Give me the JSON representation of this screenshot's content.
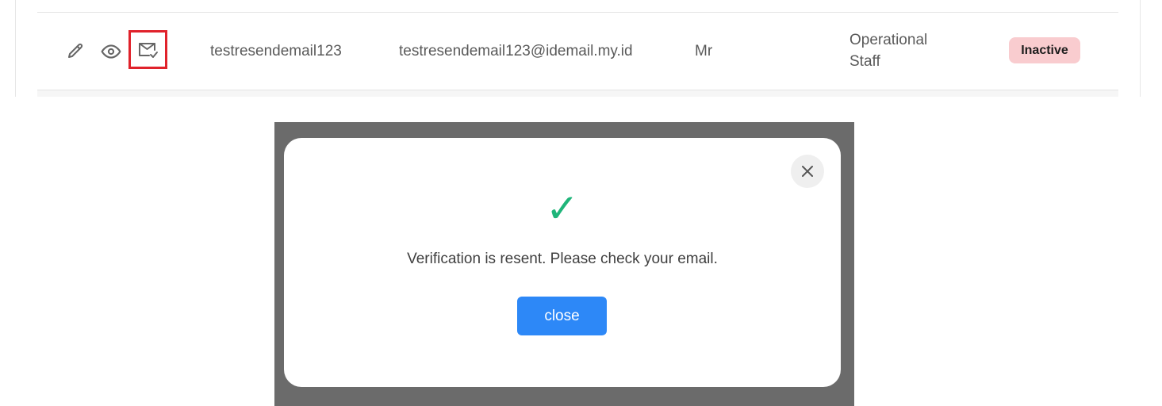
{
  "table": {
    "row": {
      "actions": [
        {
          "name": "edit",
          "icon": "pencil-icon"
        },
        {
          "name": "view",
          "icon": "eye-icon"
        },
        {
          "name": "resend-verification",
          "icon": "mail-check-icon",
          "highlighted": true,
          "highlight_color": "#e0222b"
        }
      ],
      "username": "testresendemail123",
      "email": "testresendemail123@idemail.my.id",
      "title": "Mr",
      "role": "Operational Staff",
      "status": "Inactive",
      "status_color": "#f9cccf"
    }
  },
  "modal": {
    "icon": "check-mark-icon",
    "icon_color": "#1fb57a",
    "check_glyph": "✓",
    "message": "Verification is resent. Please check your email.",
    "close_button_label": "close",
    "close_button_color": "#2d88f7",
    "dismiss_icon": "close-icon"
  }
}
